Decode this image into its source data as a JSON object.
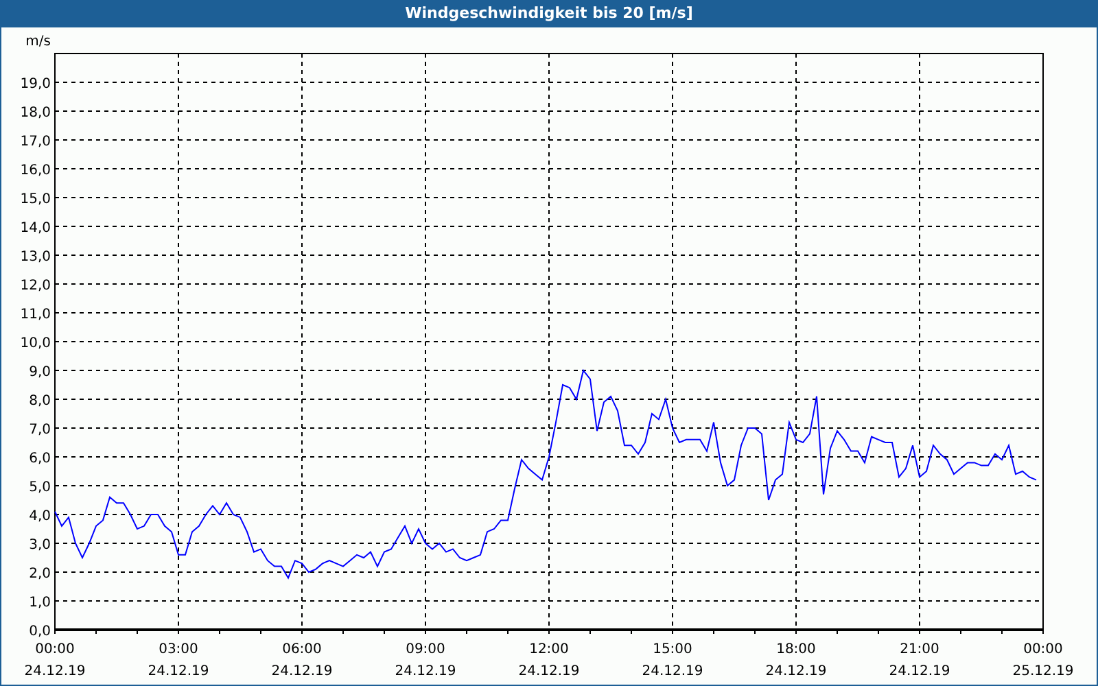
{
  "chart": {
    "title": "Windgeschwindigkeit bis 20 [m/s]",
    "chart_data": {
      "type": "line",
      "grid": true,
      "ylabel": "m/s",
      "ylim": [
        0,
        20
      ],
      "yticks": [
        {
          "value": 0,
          "label": "0,0"
        },
        {
          "value": 1,
          "label": "1,0"
        },
        {
          "value": 2,
          "label": "2,0"
        },
        {
          "value": 3,
          "label": "3,0"
        },
        {
          "value": 4,
          "label": "4,0"
        },
        {
          "value": 5,
          "label": "5,0"
        },
        {
          "value": 6,
          "label": "6,0"
        },
        {
          "value": 7,
          "label": "7,0"
        },
        {
          "value": 8,
          "label": "8,0"
        },
        {
          "value": 9,
          "label": "9,0"
        },
        {
          "value": 10,
          "label": "10,0"
        },
        {
          "value": 11,
          "label": "11,0"
        },
        {
          "value": 12,
          "label": "12,0"
        },
        {
          "value": 13,
          "label": "13,0"
        },
        {
          "value": 14,
          "label": "14,0"
        },
        {
          "value": 15,
          "label": "15,0"
        },
        {
          "value": 16,
          "label": "16,0"
        },
        {
          "value": 17,
          "label": "17,0"
        },
        {
          "value": 18,
          "label": "18,0"
        },
        {
          "value": 19,
          "label": "19,0"
        }
      ],
      "categories": [
        "00:00\n24.12.19",
        null,
        null,
        null,
        null,
        null,
        null,
        null,
        null,
        null,
        null,
        null,
        null,
        null,
        null,
        null,
        null,
        null,
        "03:00\n24.12.19",
        null,
        null,
        null,
        null,
        null,
        null,
        null,
        null,
        null,
        null,
        null,
        null,
        null,
        null,
        null,
        null,
        null,
        "06:00\n24.12.19",
        null,
        null,
        null,
        null,
        null,
        null,
        null,
        null,
        null,
        null,
        null,
        null,
        null,
        null,
        null,
        null,
        null,
        "09:00\n24.12.19",
        null,
        null,
        null,
        null,
        null,
        null,
        null,
        null,
        null,
        null,
        null,
        null,
        null,
        null,
        null,
        null,
        null,
        "12:00\n24.12.19",
        null,
        null,
        null,
        null,
        null,
        null,
        null,
        null,
        null,
        null,
        null,
        null,
        null,
        null,
        null,
        null,
        null,
        "15:00\n24.12.19",
        null,
        null,
        null,
        null,
        null,
        null,
        null,
        null,
        null,
        null,
        null,
        null,
        null,
        null,
        null,
        null,
        null,
        "18:00\n24.12.19",
        null,
        null,
        null,
        null,
        null,
        null,
        null,
        null,
        null,
        null,
        null,
        null,
        null,
        null,
        null,
        null,
        null,
        "21:00\n24.12.19",
        null,
        null,
        null,
        null,
        null,
        null,
        null,
        null,
        null,
        null,
        null,
        null,
        null,
        null,
        null,
        null,
        null,
        "00:00\n25.12.19"
      ],
      "series": [
        {
          "color": "#0000ff",
          "values": [
            4.1,
            3.6,
            3.9,
            3.0,
            2.5,
            3.0,
            3.6,
            3.8,
            4.6,
            4.4,
            4.4,
            4.0,
            3.5,
            3.6,
            4.0,
            4.0,
            3.6,
            3.4,
            2.6,
            2.6,
            3.4,
            3.6,
            4.0,
            4.3,
            4.0,
            4.4,
            4.0,
            3.9,
            3.4,
            2.7,
            2.8,
            2.4,
            2.2,
            2.2,
            1.8,
            2.4,
            2.3,
            2.0,
            2.1,
            2.3,
            2.4,
            2.3,
            2.2,
            2.4,
            2.6,
            2.5,
            2.7,
            2.2,
            2.7,
            2.8,
            3.2,
            3.6,
            3.0,
            3.5,
            3.0,
            2.8,
            3.0,
            2.7,
            2.8,
            2.5,
            2.4,
            2.5,
            2.6,
            3.4,
            3.5,
            3.8,
            3.8,
            4.9,
            5.9,
            5.6,
            5.4,
            5.2,
            6.0,
            7.2,
            8.5,
            8.4,
            8.0,
            9.0,
            8.7,
            6.9,
            7.9,
            8.1,
            7.6,
            6.4,
            6.4,
            6.1,
            6.5,
            7.5,
            7.3,
            8.0,
            7.0,
            6.5,
            6.6,
            6.6,
            6.6,
            6.2,
            7.2,
            5.8,
            5.0,
            5.2,
            6.4,
            7.0,
            7.0,
            6.8,
            4.5,
            5.2,
            5.4,
            7.2,
            6.6,
            6.5,
            6.8,
            8.1,
            4.7,
            6.3,
            6.9,
            6.6,
            6.2,
            6.2,
            5.8,
            6.7,
            6.6,
            6.5,
            6.5,
            5.3,
            5.6,
            6.4,
            5.3,
            5.5,
            6.4,
            6.1,
            5.9,
            5.4,
            5.6,
            5.8,
            5.8,
            5.7,
            5.7,
            6.1,
            5.9,
            6.4,
            5.4,
            5.5,
            5.3,
            5.2,
            null
          ]
        }
      ]
    }
  }
}
